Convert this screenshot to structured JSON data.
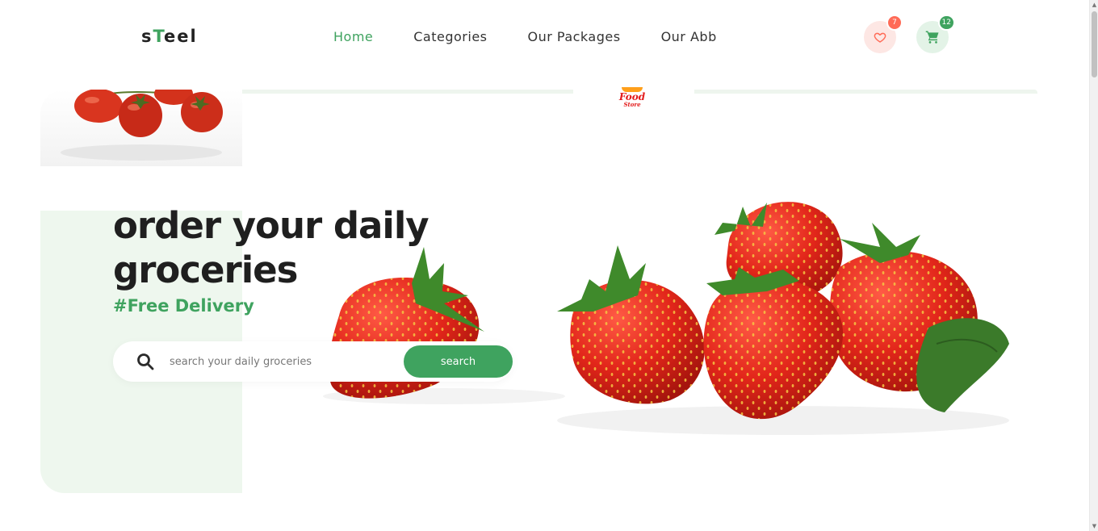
{
  "header": {
    "logo_prefix": "s",
    "logo_accent": "T",
    "logo_suffix": "eel",
    "nav": [
      {
        "label": "Home",
        "active": true
      },
      {
        "label": "Categories",
        "active": false
      },
      {
        "label": "Our Packages",
        "active": false
      },
      {
        "label": "Our Abb",
        "active": false
      }
    ],
    "wishlist_count": "7",
    "cart_count": "12",
    "wishlist_icon": "heart-icon",
    "cart_icon": "cart-icon"
  },
  "hero": {
    "brand_badge_line1": "Food",
    "brand_badge_line2": "Store",
    "headline": "order your daily groceries",
    "tagline": "#Free Delivery",
    "search_placeholder": "search your daily groceries",
    "search_button": "search"
  },
  "colors": {
    "accent_green": "#3fa35f",
    "badge_red": "#ff6b57",
    "panel_green": "#eef7ee"
  }
}
